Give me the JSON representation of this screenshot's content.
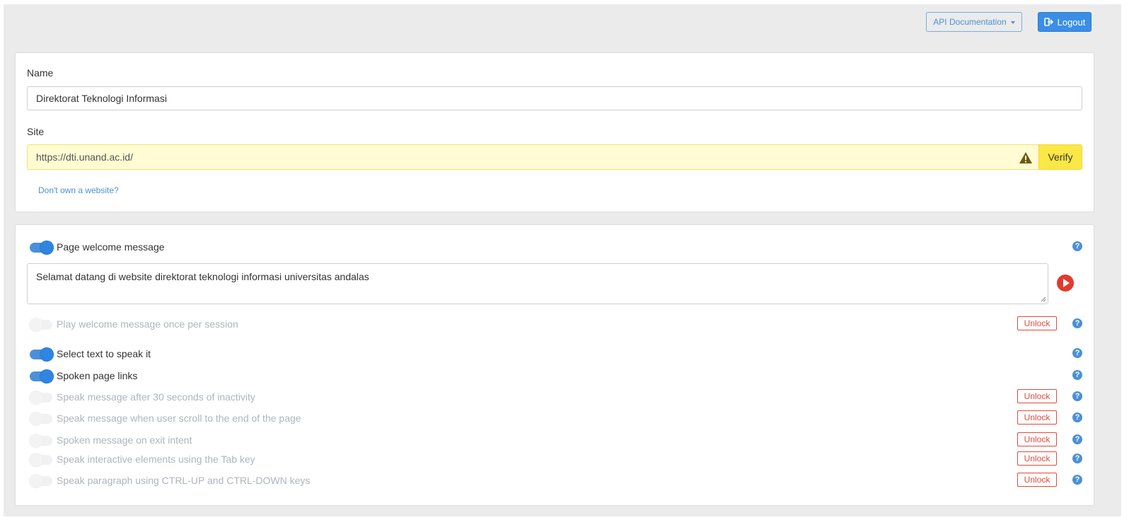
{
  "header": {
    "api_documentation_label": "API Documentation",
    "logout_label": "Logout"
  },
  "site_form": {
    "name_label": "Name",
    "name_value": "Direktorat Teknologi Informasi",
    "site_label": "Site",
    "site_value": "https://dti.unand.ac.id/",
    "verify_label": "Verify",
    "no_website_link": "Don't own a website?"
  },
  "settings": {
    "welcome": {
      "label": "Page welcome message",
      "enabled": true,
      "message": "Selamat datang di website direktorat teknologi informasi universitas andalas"
    },
    "unlock_label": "Unlock",
    "help_glyph": "?",
    "rows": [
      {
        "label": "Play welcome message once per session",
        "enabled": false,
        "locked": true
      },
      {
        "label": "Select text to speak it",
        "enabled": true,
        "locked": false
      },
      {
        "label": "Spoken page links",
        "enabled": true,
        "locked": false
      },
      {
        "label": "Speak message after 30 seconds of inactivity",
        "enabled": false,
        "locked": true
      },
      {
        "label": "Speak message when user scroll to the end of the page",
        "enabled": false,
        "locked": true
      },
      {
        "label": "Spoken message on exit intent",
        "enabled": false,
        "locked": true
      },
      {
        "label": "Speak interactive elements using the Tab key",
        "enabled": false,
        "locked": true
      },
      {
        "label": "Speak paragraph using CTRL-UP and CTRL-DOWN keys",
        "enabled": false,
        "locked": true
      }
    ]
  },
  "colors": {
    "accent": "#4a90d9",
    "danger": "#e04a3a",
    "warning_bg": "#fffbd2",
    "verify_bg": "#fbe745"
  }
}
